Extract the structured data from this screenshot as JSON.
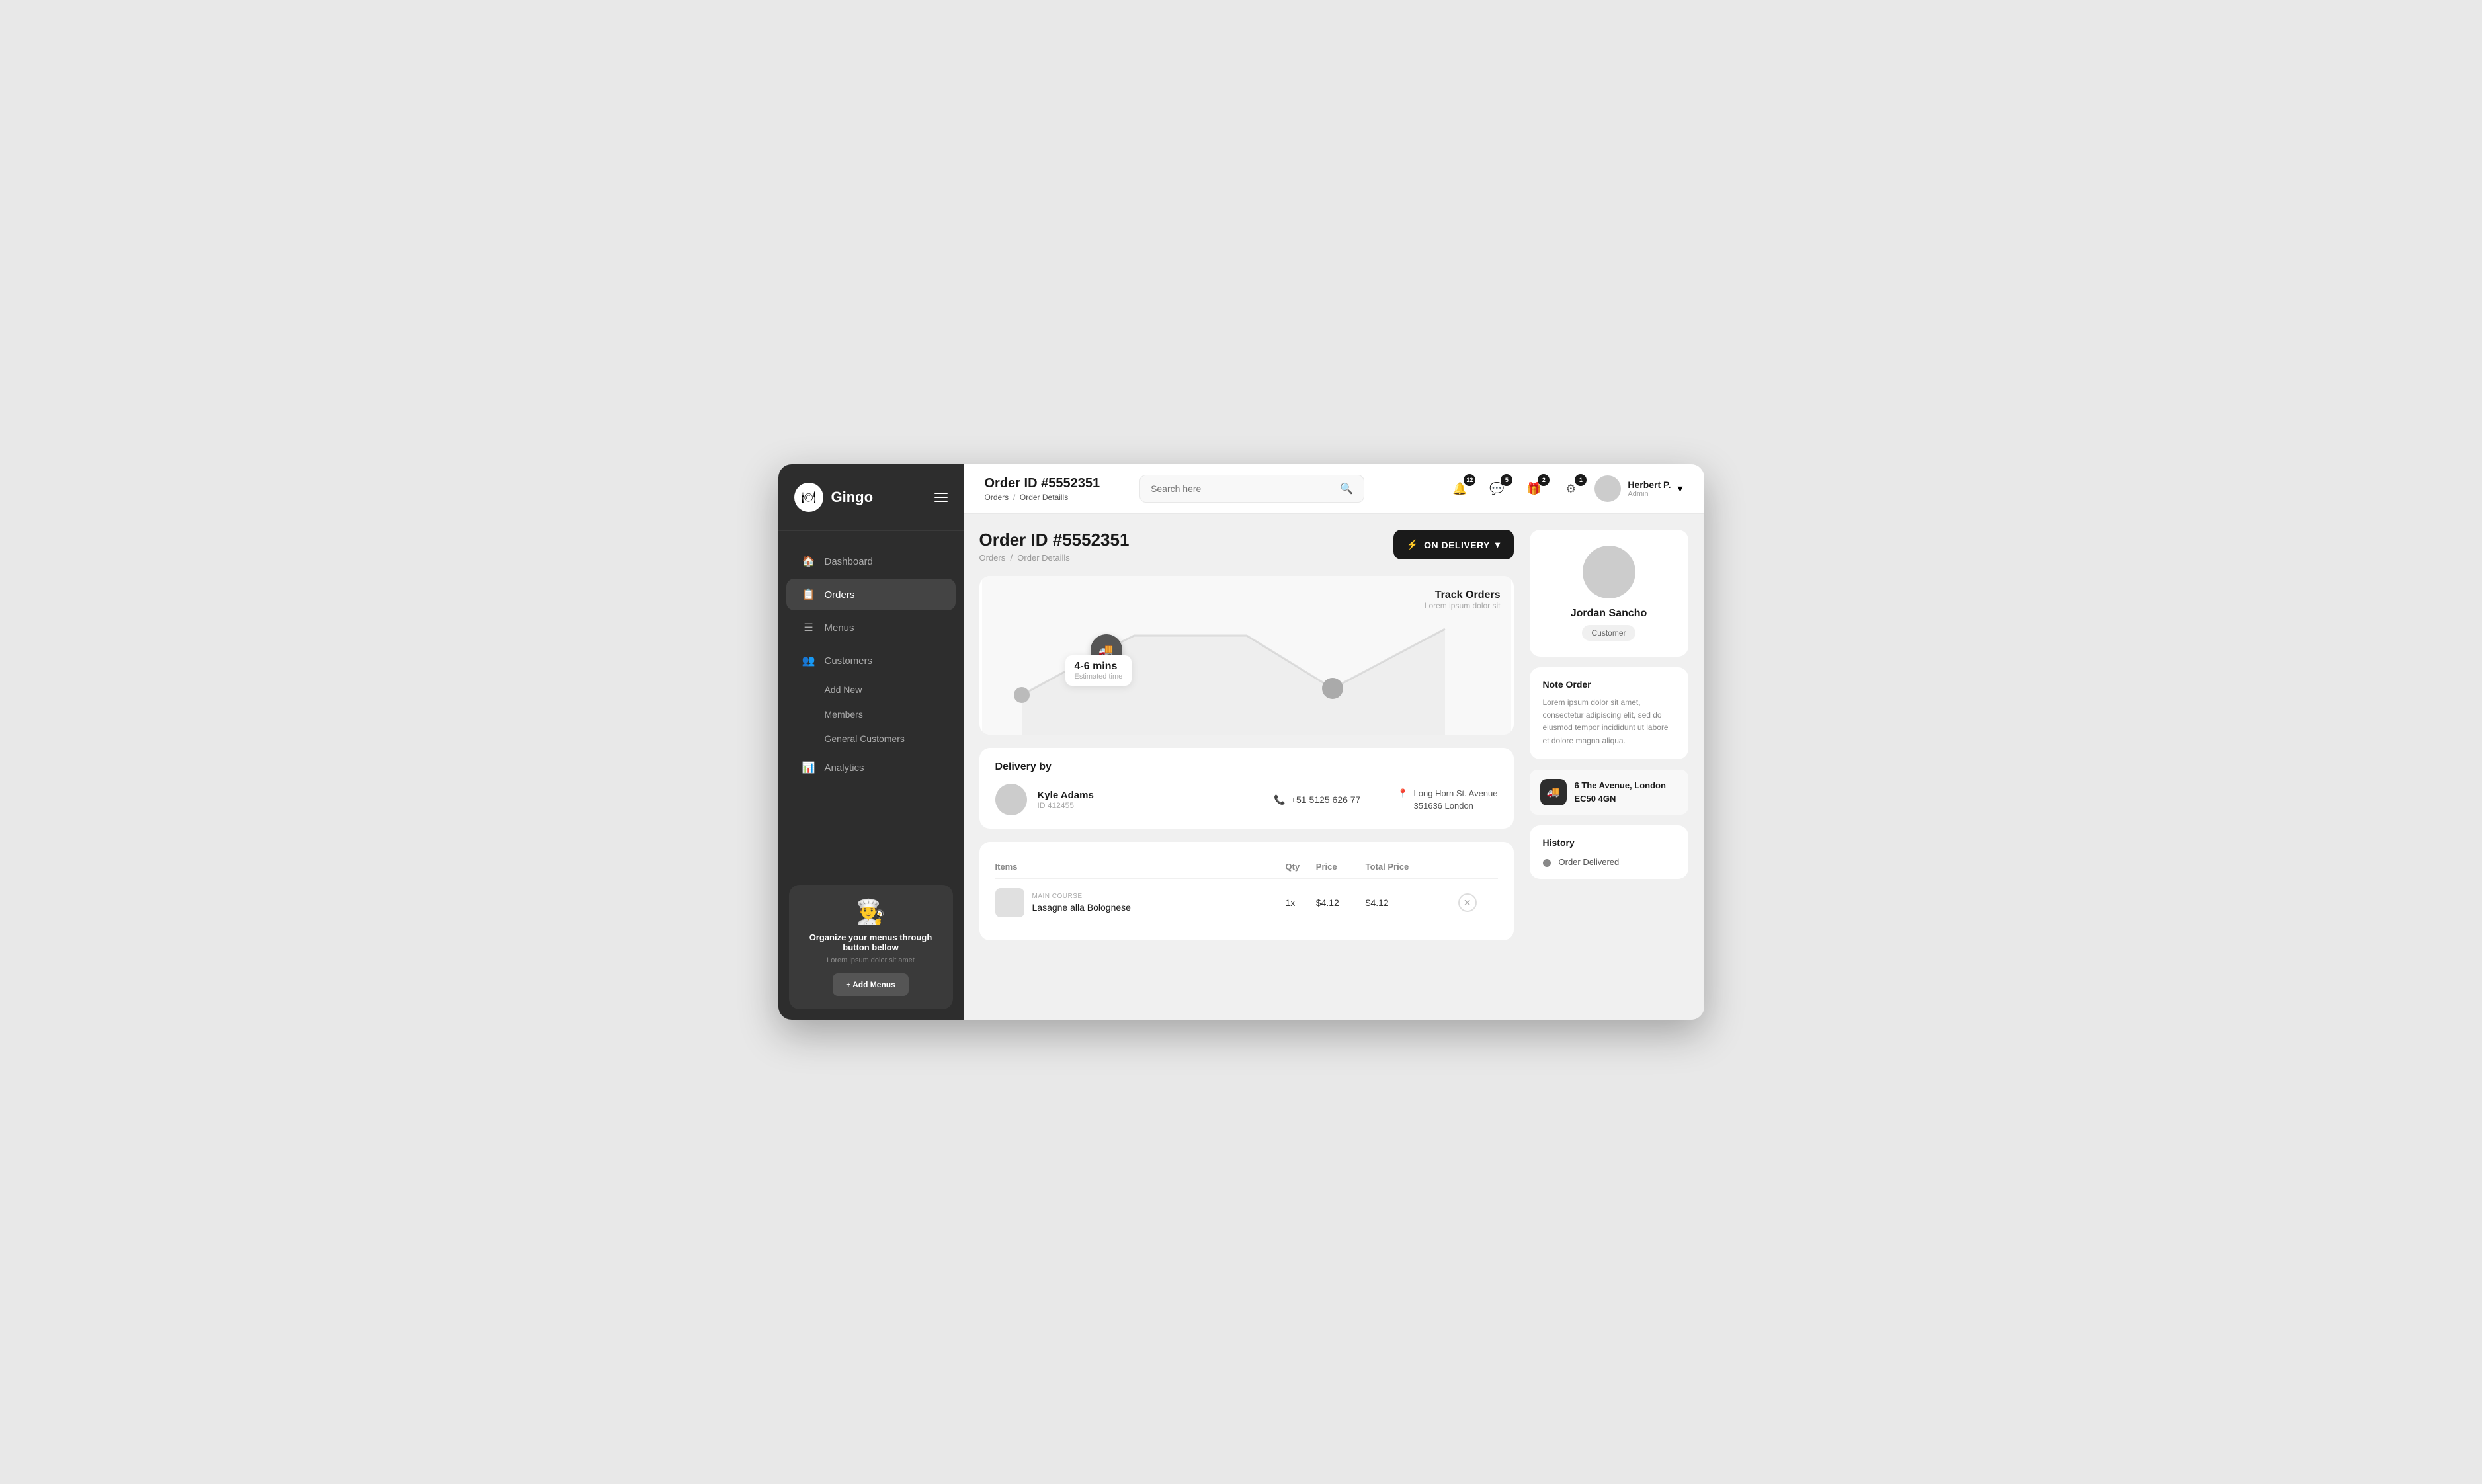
{
  "app": {
    "name": "Gingo",
    "logo_icon": "🍽"
  },
  "sidebar": {
    "nav_items": [
      {
        "id": "dashboard",
        "label": "Dashboard",
        "icon": "⊞",
        "active": false
      },
      {
        "id": "orders",
        "label": "Orders",
        "icon": "📋",
        "active": true
      },
      {
        "id": "menus",
        "label": "Menus",
        "icon": "☰",
        "active": false
      },
      {
        "id": "customers",
        "label": "Customers",
        "icon": "👥",
        "active": false
      },
      {
        "id": "analytics",
        "label": "Analytics",
        "icon": "📊",
        "active": false
      }
    ],
    "sub_items": [
      {
        "id": "add-new",
        "label": "Add New"
      },
      {
        "id": "members",
        "label": "Members"
      },
      {
        "id": "general-customers",
        "label": "General Customers"
      }
    ],
    "promo": {
      "title": "Organize your menus through button bellow",
      "description": "Lorem ipsum dolor sit amet",
      "button_label": "+ Add Menus"
    }
  },
  "topbar": {
    "order_id": "Order ID #5552351",
    "breadcrumb_parent": "Orders",
    "breadcrumb_current": "Order Detaills",
    "search_placeholder": "Search here",
    "notifications": [
      {
        "id": "bell",
        "count": "12",
        "icon": "🔔"
      },
      {
        "id": "chat",
        "count": "5",
        "icon": "💬"
      },
      {
        "id": "gift",
        "count": "2",
        "icon": "🎁"
      },
      {
        "id": "gear",
        "count": "1",
        "icon": "⚙"
      }
    ],
    "user": {
      "name": "Herbert P.",
      "role": "Admin"
    }
  },
  "page": {
    "title": "Order ID #5552351",
    "breadcrumb_parent": "Orders",
    "breadcrumb_current": "Order Detaills",
    "status": "ON DELIVERY"
  },
  "map": {
    "track_title": "Track Orders",
    "track_subtitle": "Lorem ipsum dolor sit",
    "estimated_time": "4-6 mins",
    "estimated_label": "Estimated time"
  },
  "delivery": {
    "section_label": "Delivery by",
    "driver_name": "Kyle Adams",
    "driver_id": "ID 412455",
    "phone": "+51 5125 626 77",
    "address_line1": "Long Horn St. Avenue",
    "address_line2": "351636 London"
  },
  "items": {
    "columns": [
      "Items",
      "Qty",
      "Price",
      "Total Price"
    ],
    "rows": [
      {
        "category": "MAIN COURSE",
        "name": "Lasagne alla Bolognese",
        "qty": "1x",
        "price": "$4.12",
        "total": "$4.12"
      }
    ]
  },
  "customer": {
    "name": "Jordan Sancho",
    "badge": "Customer",
    "note_title": "Note Order",
    "note_text": "Lorem ipsum dolor sit amet, consectetur adipiscing elit, sed do eiusmod tempor incididunt ut labore et dolore magna aliqua.",
    "address": "6 The Avenue, London EC50 4GN"
  },
  "history": {
    "title": "History",
    "items": [
      {
        "label": "Order Delivered"
      }
    ]
  }
}
